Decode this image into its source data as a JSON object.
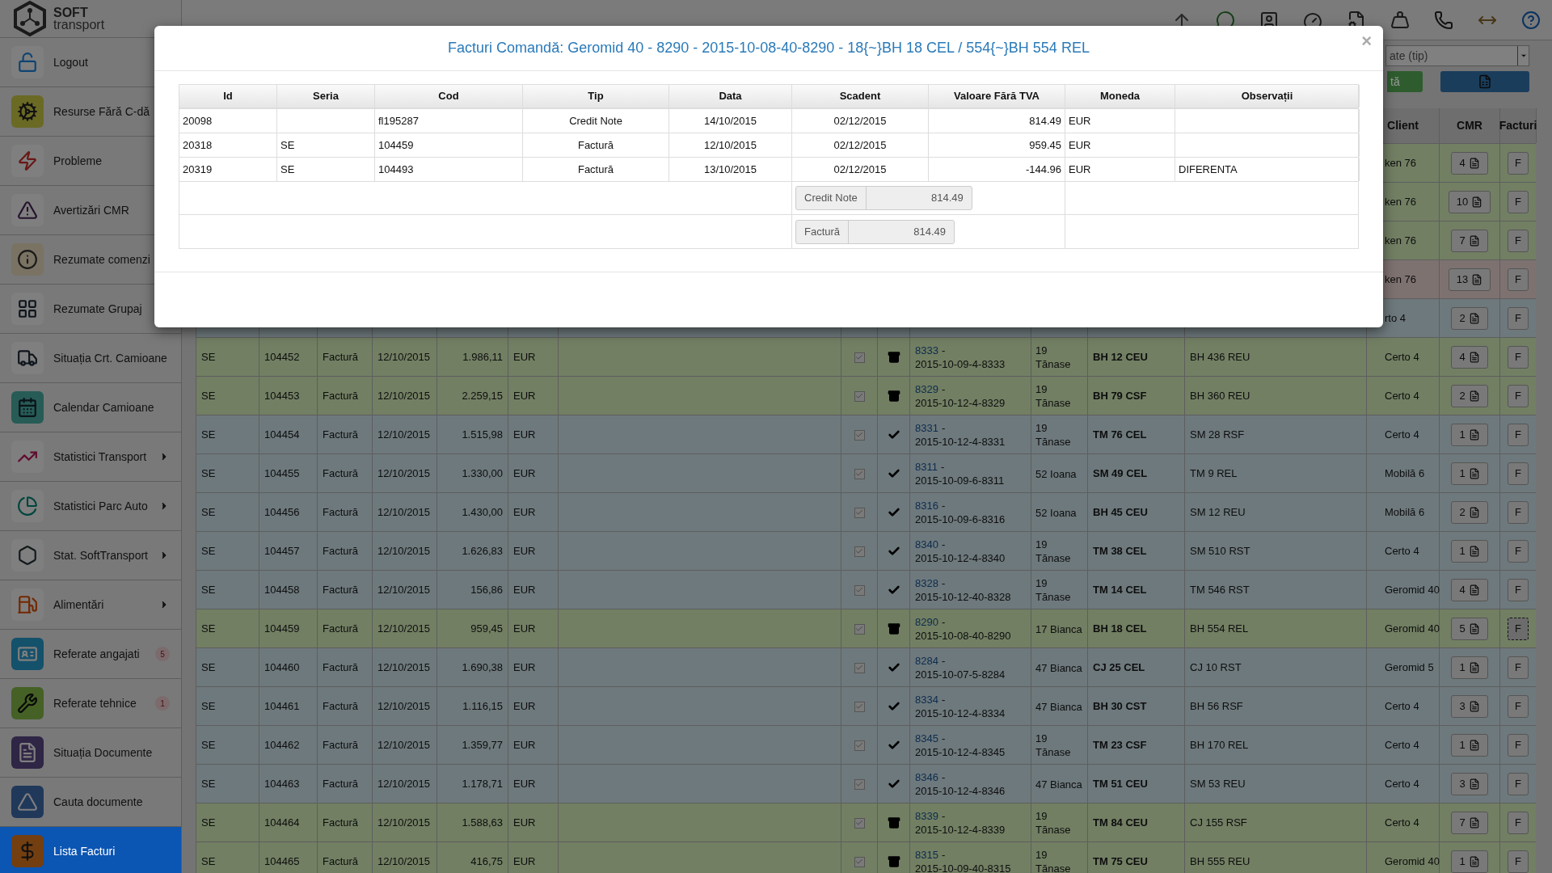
{
  "logo": {
    "top": "SOFT",
    "bottom": "transport"
  },
  "sidebar": {
    "items": [
      {
        "label": "Logout",
        "selected": false,
        "submenu": false
      },
      {
        "label": "Resurse Fără C-dă",
        "selected": false,
        "submenu": false
      },
      {
        "label": "Probleme",
        "selected": false,
        "submenu": false
      },
      {
        "label": "Avertizări CMR",
        "selected": false,
        "submenu": false
      },
      {
        "label": "Rezumate comenzi",
        "selected": false,
        "submenu": false
      },
      {
        "label": "Rezumate Grupaj",
        "selected": false,
        "submenu": false
      },
      {
        "label": "Situația Crt. Camioane",
        "selected": false,
        "submenu": false
      },
      {
        "label": "Calendar Camioane",
        "selected": false,
        "submenu": false
      },
      {
        "label": "Statistici Transport",
        "selected": false,
        "submenu": true
      },
      {
        "label": "Statistici Parc Auto",
        "selected": false,
        "submenu": true
      },
      {
        "label": "Stat. SoftTransport",
        "selected": false,
        "submenu": true
      },
      {
        "label": "Alimentări",
        "selected": false,
        "submenu": true
      },
      {
        "label": "Referate angajati",
        "selected": false,
        "submenu": false,
        "badge": "5"
      },
      {
        "label": "Referate tehnice",
        "selected": false,
        "submenu": false,
        "badge": "1"
      },
      {
        "label": "Situația Documente",
        "selected": false,
        "submenu": false
      },
      {
        "label": "Cauta documente",
        "selected": false,
        "submenu": false
      },
      {
        "label": "Lista Facturi",
        "selected": true,
        "submenu": false
      }
    ]
  },
  "toolbar": {
    "type_select": {
      "placeholder": "ate (tip)"
    },
    "green_button": "tă"
  },
  "table": {
    "columns": [
      "Client",
      "CMR",
      "Facturi"
    ],
    "rows": [
      {
        "client": "ken 76",
        "cmr": "4",
        "invoice_button": "F",
        "color": "#727f63",
        "focused": false
      },
      {
        "client": "ken 76",
        "cmr": "10",
        "invoice_button": "F",
        "color": "#727f63",
        "focused": false
      },
      {
        "client": "ken 76",
        "cmr": "7",
        "invoice_button": "F",
        "color": "#727f63",
        "focused": false
      },
      {
        "client": "ken 76",
        "cmr": "13",
        "invoice_button": "F",
        "color": "#7e7270",
        "focused": false
      },
      {
        "client": "rto 4",
        "cmr": "2",
        "invoice_button": "F",
        "color": "#6e797d",
        "focused": false
      },
      {
        "seria": "SE",
        "cod": "104452",
        "tip": "Factură",
        "data": "12/10/2015",
        "valoare": "1.986,11",
        "moneda": "EUR",
        "checked": true,
        "archived": true,
        "order_id": "8333",
        "order_sep": "-",
        "order_code": "2015-10-09-4-8333",
        "driver": "19 Tănase",
        "truck": "BH 12 CEU",
        "trailer": "BH 436 REU",
        "client": "Certo 4",
        "cmr": "4",
        "invoice_button": "F",
        "color": "#727f63",
        "focused": false
      },
      {
        "seria": "SE",
        "cod": "104453",
        "tip": "Factură",
        "data": "12/10/2015",
        "valoare": "2.259,15",
        "moneda": "EUR",
        "checked": true,
        "archived": true,
        "order_id": "8329",
        "order_sep": "-",
        "order_code": "2015-10-12-4-8329",
        "driver": "19 Tănase",
        "truck": "BH 79 CSF",
        "trailer": "BH 360 REU",
        "client": "Certo 4",
        "cmr": "2",
        "invoice_button": "F",
        "color": "#727f63",
        "focused": false
      },
      {
        "seria": "SE",
        "cod": "104454",
        "tip": "Factură",
        "data": "12/10/2015",
        "valoare": "1.515,98",
        "moneda": "EUR",
        "checked": true,
        "archived": false,
        "order_id": "8331",
        "order_sep": "-",
        "order_code": "2015-10-12-4-8331",
        "driver": "19 Tănase",
        "truck": "TM 76 CEL",
        "trailer": "SM 28 RSF",
        "client": "Certo 4",
        "cmr": "1",
        "invoice_button": "F",
        "color": "#6e797d",
        "focused": false
      },
      {
        "seria": "SE",
        "cod": "104455",
        "tip": "Factură",
        "data": "12/10/2015",
        "valoare": "1.330,00",
        "moneda": "EUR",
        "checked": true,
        "archived": false,
        "order_id": "8311",
        "order_sep": "-",
        "order_code": "2015-10-09-6-8311",
        "driver": "52 Ioana",
        "truck": "SM 49 CEL",
        "trailer": "TM 9 REL",
        "client": "Mobilă 6",
        "cmr": "1",
        "invoice_button": "F",
        "color": "#6e797d",
        "focused": false
      },
      {
        "seria": "SE",
        "cod": "104456",
        "tip": "Factură",
        "data": "12/10/2015",
        "valoare": "1.430,00",
        "moneda": "EUR",
        "checked": true,
        "archived": false,
        "order_id": "8316",
        "order_sep": "-",
        "order_code": "2015-10-09-6-8316",
        "driver": "52 Ioana",
        "truck": "BH 45 CEU",
        "trailer": "SM 12 REU",
        "client": "Mobilă 6",
        "cmr": "2",
        "invoice_button": "F",
        "color": "#6e797d",
        "focused": false
      },
      {
        "seria": "SE",
        "cod": "104457",
        "tip": "Factură",
        "data": "12/10/2015",
        "valoare": "1.626,83",
        "moneda": "EUR",
        "checked": true,
        "archived": false,
        "order_id": "8340",
        "order_sep": "-",
        "order_code": "2015-10-12-4-8340",
        "driver": "19 Tănase",
        "truck": "TM 38 CEL",
        "trailer": "SM 510 RST",
        "client": "Certo 4",
        "cmr": "1",
        "invoice_button": "F",
        "color": "#6e797d",
        "focused": false
      },
      {
        "seria": "SE",
        "cod": "104458",
        "tip": "Factură",
        "data": "12/10/2015",
        "valoare": "156,86",
        "moneda": "EUR",
        "checked": true,
        "archived": false,
        "order_id": "8328",
        "order_sep": "-",
        "order_code": "2015-10-12-40-8328",
        "driver": "19 Tănase",
        "truck": "TM 14 CEL",
        "trailer": "TM 546 RST",
        "client": "Geromid 40",
        "cmr": "4",
        "invoice_button": "F",
        "color": "#6e797d",
        "focused": false
      },
      {
        "seria": "SE",
        "cod": "104459",
        "tip": "Factură",
        "data": "12/10/2015",
        "valoare": "959,45",
        "moneda": "EUR",
        "checked": true,
        "archived": true,
        "order_id": "8290",
        "order_sep": "-",
        "order_code": "2015-10-08-40-8290",
        "driver": "17 Bianca",
        "truck": "BH 18 CEL",
        "trailer": "BH 554 REL",
        "client": "Geromid 40",
        "cmr": "5",
        "invoice_button": "F",
        "color": "#727f63",
        "focused": true
      },
      {
        "seria": "SE",
        "cod": "104460",
        "tip": "Factură",
        "data": "12/10/2015",
        "valoare": "1.690,38",
        "moneda": "EUR",
        "checked": true,
        "archived": false,
        "order_id": "8284",
        "order_sep": "-",
        "order_code": "2015-10-07-5-8284",
        "driver": "47 Bianca",
        "truck": "CJ 25 CEL",
        "trailer": "CJ 10 RST",
        "client": "Geromid 5",
        "cmr": "1",
        "invoice_button": "F",
        "color": "#6e797d",
        "focused": false
      },
      {
        "seria": "SE",
        "cod": "104461",
        "tip": "Factură",
        "data": "12/10/2015",
        "valoare": "1.116,15",
        "moneda": "EUR",
        "checked": true,
        "archived": false,
        "order_id": "8334",
        "order_sep": "-",
        "order_code": "2015-10-12-4-8334",
        "driver": "47 Bianca",
        "truck": "BH 30 CST",
        "trailer": "BH 56 RSF",
        "client": "Certo 4",
        "cmr": "3",
        "invoice_button": "F",
        "color": "#6e797d",
        "focused": false
      },
      {
        "seria": "SE",
        "cod": "104462",
        "tip": "Factură",
        "data": "12/10/2015",
        "valoare": "1.359,77",
        "moneda": "EUR",
        "checked": true,
        "archived": false,
        "order_id": "8345",
        "order_sep": "-",
        "order_code": "2015-10-12-4-8345",
        "driver": "19 Tănase",
        "truck": "TM 23 CSF",
        "trailer": "BH 170 REL",
        "client": "Certo 4",
        "cmr": "1",
        "invoice_button": "F",
        "color": "#6e797d",
        "focused": false
      },
      {
        "seria": "SE",
        "cod": "104463",
        "tip": "Factură",
        "data": "12/10/2015",
        "valoare": "1.178,71",
        "moneda": "EUR",
        "checked": true,
        "archived": false,
        "order_id": "8346",
        "order_sep": "-",
        "order_code": "2015-10-12-4-8346",
        "driver": "47 Bianca",
        "truck": "TM 51 CEU",
        "trailer": "SM 53 REU",
        "client": "Certo 4",
        "cmr": "3",
        "invoice_button": "F",
        "color": "#6e797d",
        "focused": false
      },
      {
        "seria": "SE",
        "cod": "104464",
        "tip": "Factură",
        "data": "12/10/2015",
        "valoare": "1.588,63",
        "moneda": "EUR",
        "checked": true,
        "archived": true,
        "order_id": "8339",
        "order_sep": "-",
        "order_code": "2015-10-12-4-8339",
        "driver": "19 Tănase",
        "truck": "TM 84 CEU",
        "trailer": "CJ 155 RSF",
        "client": "Certo 4",
        "cmr": "7",
        "invoice_button": "F",
        "color": "#727f63",
        "focused": false
      },
      {
        "seria": "SE",
        "cod": "104465",
        "tip": "Factură",
        "data": "12/10/2015",
        "valoare": "416,75",
        "moneda": "EUR",
        "checked": true,
        "archived": true,
        "order_id": "8315",
        "order_sep": "-",
        "order_code": "2015-10-09-40-8315",
        "driver": "19 Tănase",
        "truck": "TM 75 CEU",
        "trailer": "BH 555 REU",
        "client": "Geromid 40",
        "cmr": "1",
        "invoice_button": "F",
        "color": "#727f63",
        "focused": false
      }
    ]
  },
  "modal": {
    "title": "Facturi Comandă: Geromid 40 - 8290 - 2015-10-08-40-8290 - 18{~}BH 18 CEL / 554{~}BH 554 REL",
    "close": "×",
    "columns": [
      "Id",
      "Seria",
      "Cod",
      "Tip",
      "Data",
      "Scadent",
      "Valoare Fără TVA",
      "Moneda",
      "Observații"
    ],
    "rows": [
      [
        "20098",
        "",
        "fl195287",
        "Credit Note",
        "14/10/2015",
        "02/12/2015",
        "814.49",
        "EUR",
        ""
      ],
      [
        "20318",
        "SE",
        "104459",
        "Factură",
        "12/10/2015",
        "02/12/2015",
        "959.45",
        "EUR",
        ""
      ],
      [
        "20319",
        "SE",
        "104493",
        "Factură",
        "13/10/2015",
        "02/12/2015",
        "-144.96",
        "EUR",
        "DIFERENTA"
      ]
    ],
    "totals": [
      {
        "label": "Credit Note",
        "value": "814.49"
      },
      {
        "label": "Factură",
        "value": "814.49"
      }
    ]
  }
}
